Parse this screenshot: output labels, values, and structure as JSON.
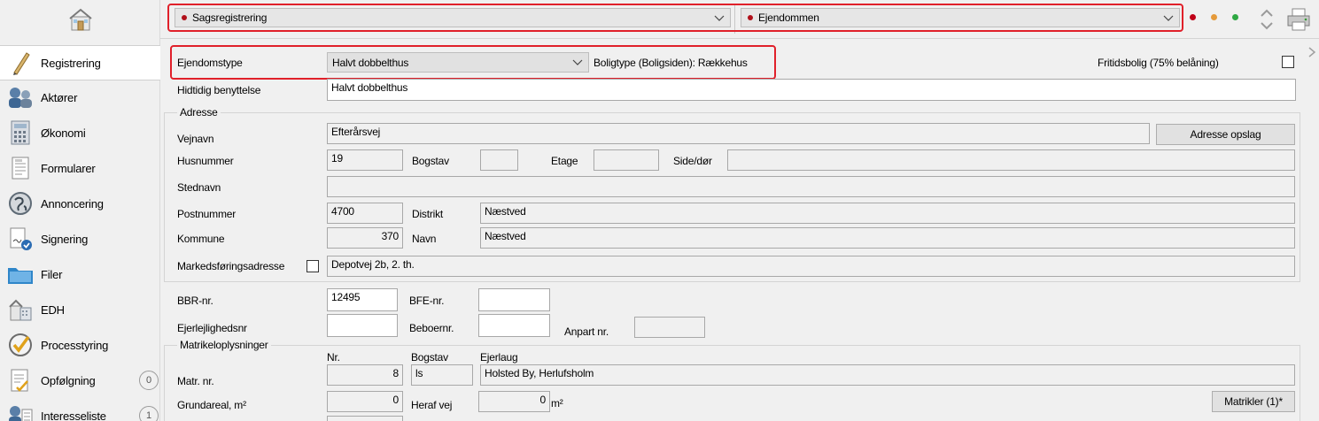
{
  "sidebar": {
    "home_icon": "home-icon",
    "items": [
      {
        "label": "Registrering",
        "icon": "pencil-icon",
        "active": true
      },
      {
        "label": "Aktører",
        "icon": "people-icon"
      },
      {
        "label": "Økonomi",
        "icon": "calculator-icon"
      },
      {
        "label": "Formularer",
        "icon": "document-icon"
      },
      {
        "label": "Annoncering",
        "icon": "globe-icon"
      },
      {
        "label": "Signering",
        "icon": "signature-icon"
      },
      {
        "label": "Filer",
        "icon": "folder-icon"
      },
      {
        "label": "EDH",
        "icon": "edh-icon"
      },
      {
        "label": "Processtyring",
        "icon": "checkmark-icon"
      },
      {
        "label": "Opfølgning",
        "icon": "checklist-icon",
        "count": "0"
      },
      {
        "label": "Interesseliste",
        "icon": "people-list-icon",
        "count": "1"
      }
    ]
  },
  "topbar": {
    "combo1": "Sagsregistrering",
    "combo2": "Ejendommen",
    "status_dots": [
      "#c00018",
      "#e59a3a",
      "#2ea843"
    ],
    "marker_color": "#b0101a"
  },
  "row1": {
    "ejendomstype_label": "Ejendomstype",
    "ejendomstype_value": "Halvt dobbelthus",
    "boligtype_text": "Boligtype (Boligsiden): Rækkehus",
    "fritidsbolig_label": "Fritidsbolig (75% belåning)"
  },
  "hidtidig": {
    "label": "Hidtidig benyttelse",
    "value": "Halvt dobbelthus"
  },
  "adresse": {
    "title": "Adresse",
    "vejnavn_label": "Vejnavn",
    "vejnavn_value": "Efterårsvej",
    "opslag_button": "Adresse opslag",
    "husnummer_label": "Husnummer",
    "husnummer_value": "19",
    "bogstav_label": "Bogstav",
    "bogstav_value": "",
    "etage_label": "Etage",
    "etage_value": "",
    "sidedor_label": "Side/dør",
    "sidedor_value": "",
    "stednavn_label": "Stednavn",
    "stednavn_value": "",
    "postnummer_label": "Postnummer",
    "postnummer_value": "4700",
    "distrikt_label": "Distrikt",
    "distrikt_value": "Næstved",
    "kommune_label": "Kommune",
    "kommune_value": "370",
    "navn_label": "Navn",
    "navn_value": "Næstved",
    "markeds_label": "Markedsføringsadresse",
    "markeds_value": "Depotvej 2b, 2. th."
  },
  "bbr": {
    "bbr_label": "BBR-nr.",
    "bbr_value": "12495",
    "bfe_label": "BFE-nr.",
    "bfe_value": "",
    "ejerlej_label": "Ejerlejlighedsnr",
    "ejerlej_value": "",
    "beboer_label": "Beboernr.",
    "beboer_value": "",
    "anpart_label": "Anpart nr.",
    "anpart_value": ""
  },
  "matrikel": {
    "title": "Matrikeloplysninger",
    "col_nr": "Nr.",
    "col_bogstav": "Bogstav",
    "col_ejerlaug": "Ejerlaug",
    "matr_label": "Matr. nr.",
    "matr_nr": "8",
    "matr_bogstav": "ls",
    "matr_ejerlaug": "Holsted By, Herlufsholm",
    "grundareal_label": "Grundareal, m²",
    "grundareal_value": "0",
    "herafvej_label": "Heraf vej",
    "herafvej_value": "0",
    "herafvej_unit": "m²",
    "matrikler_button": "Matrikler (1)*"
  }
}
